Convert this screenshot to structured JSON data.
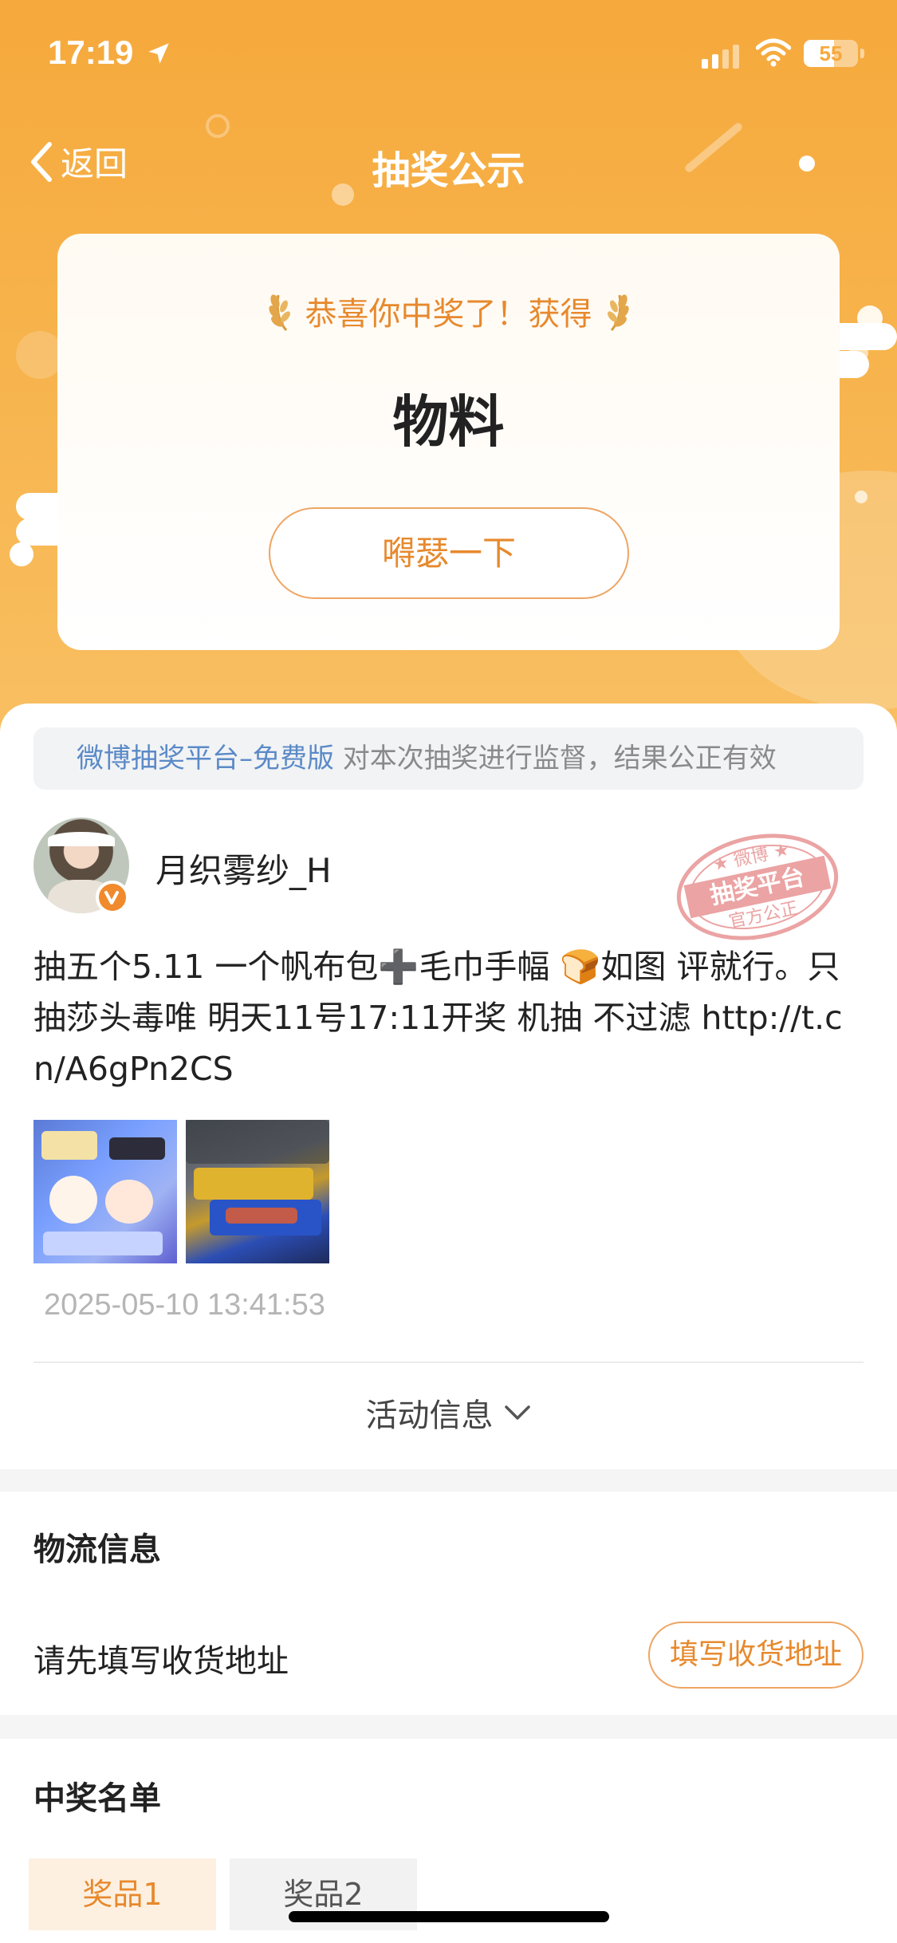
{
  "status_bar": {
    "time": "17:19",
    "battery": "55",
    "icons": [
      "location-arrow-icon",
      "signal-icon",
      "wifi-icon",
      "battery-icon"
    ]
  },
  "nav": {
    "back_label": "返回",
    "title": "抽奖公示"
  },
  "prize_card": {
    "congrats": "恭喜你中奖了！获得",
    "prize": "物料",
    "share_button": "嘚瑟一下"
  },
  "notice": {
    "platform": "微博抽奖平台–免费版",
    "text": " 对本次抽奖进行监督，结果公正有效"
  },
  "post": {
    "username": "月织雾纱_H",
    "stamp": {
      "top": "微博",
      "middle": "抽奖平台",
      "bottom": "官方公正"
    },
    "text": "抽五个5.11 一个帆布包➕毛巾手幅 🍞如图 评就行。只抽莎头毒唯 明天11号17:11开奖 机抽 不过滤  http://t.cn/A6gPn2CS",
    "timestamp": "2025-05-10 13:41:53",
    "activity_info": "活动信息"
  },
  "logistics": {
    "title": "物流信息",
    "address_prompt": "请先填写收货地址",
    "address_button": "填写收货地址"
  },
  "winners": {
    "title": "中奖名单",
    "tabs": [
      "奖品1",
      "奖品2"
    ]
  },
  "colors": {
    "accent": "#e7892d",
    "hero": "#f6a93c",
    "link": "#5b8ac7"
  }
}
